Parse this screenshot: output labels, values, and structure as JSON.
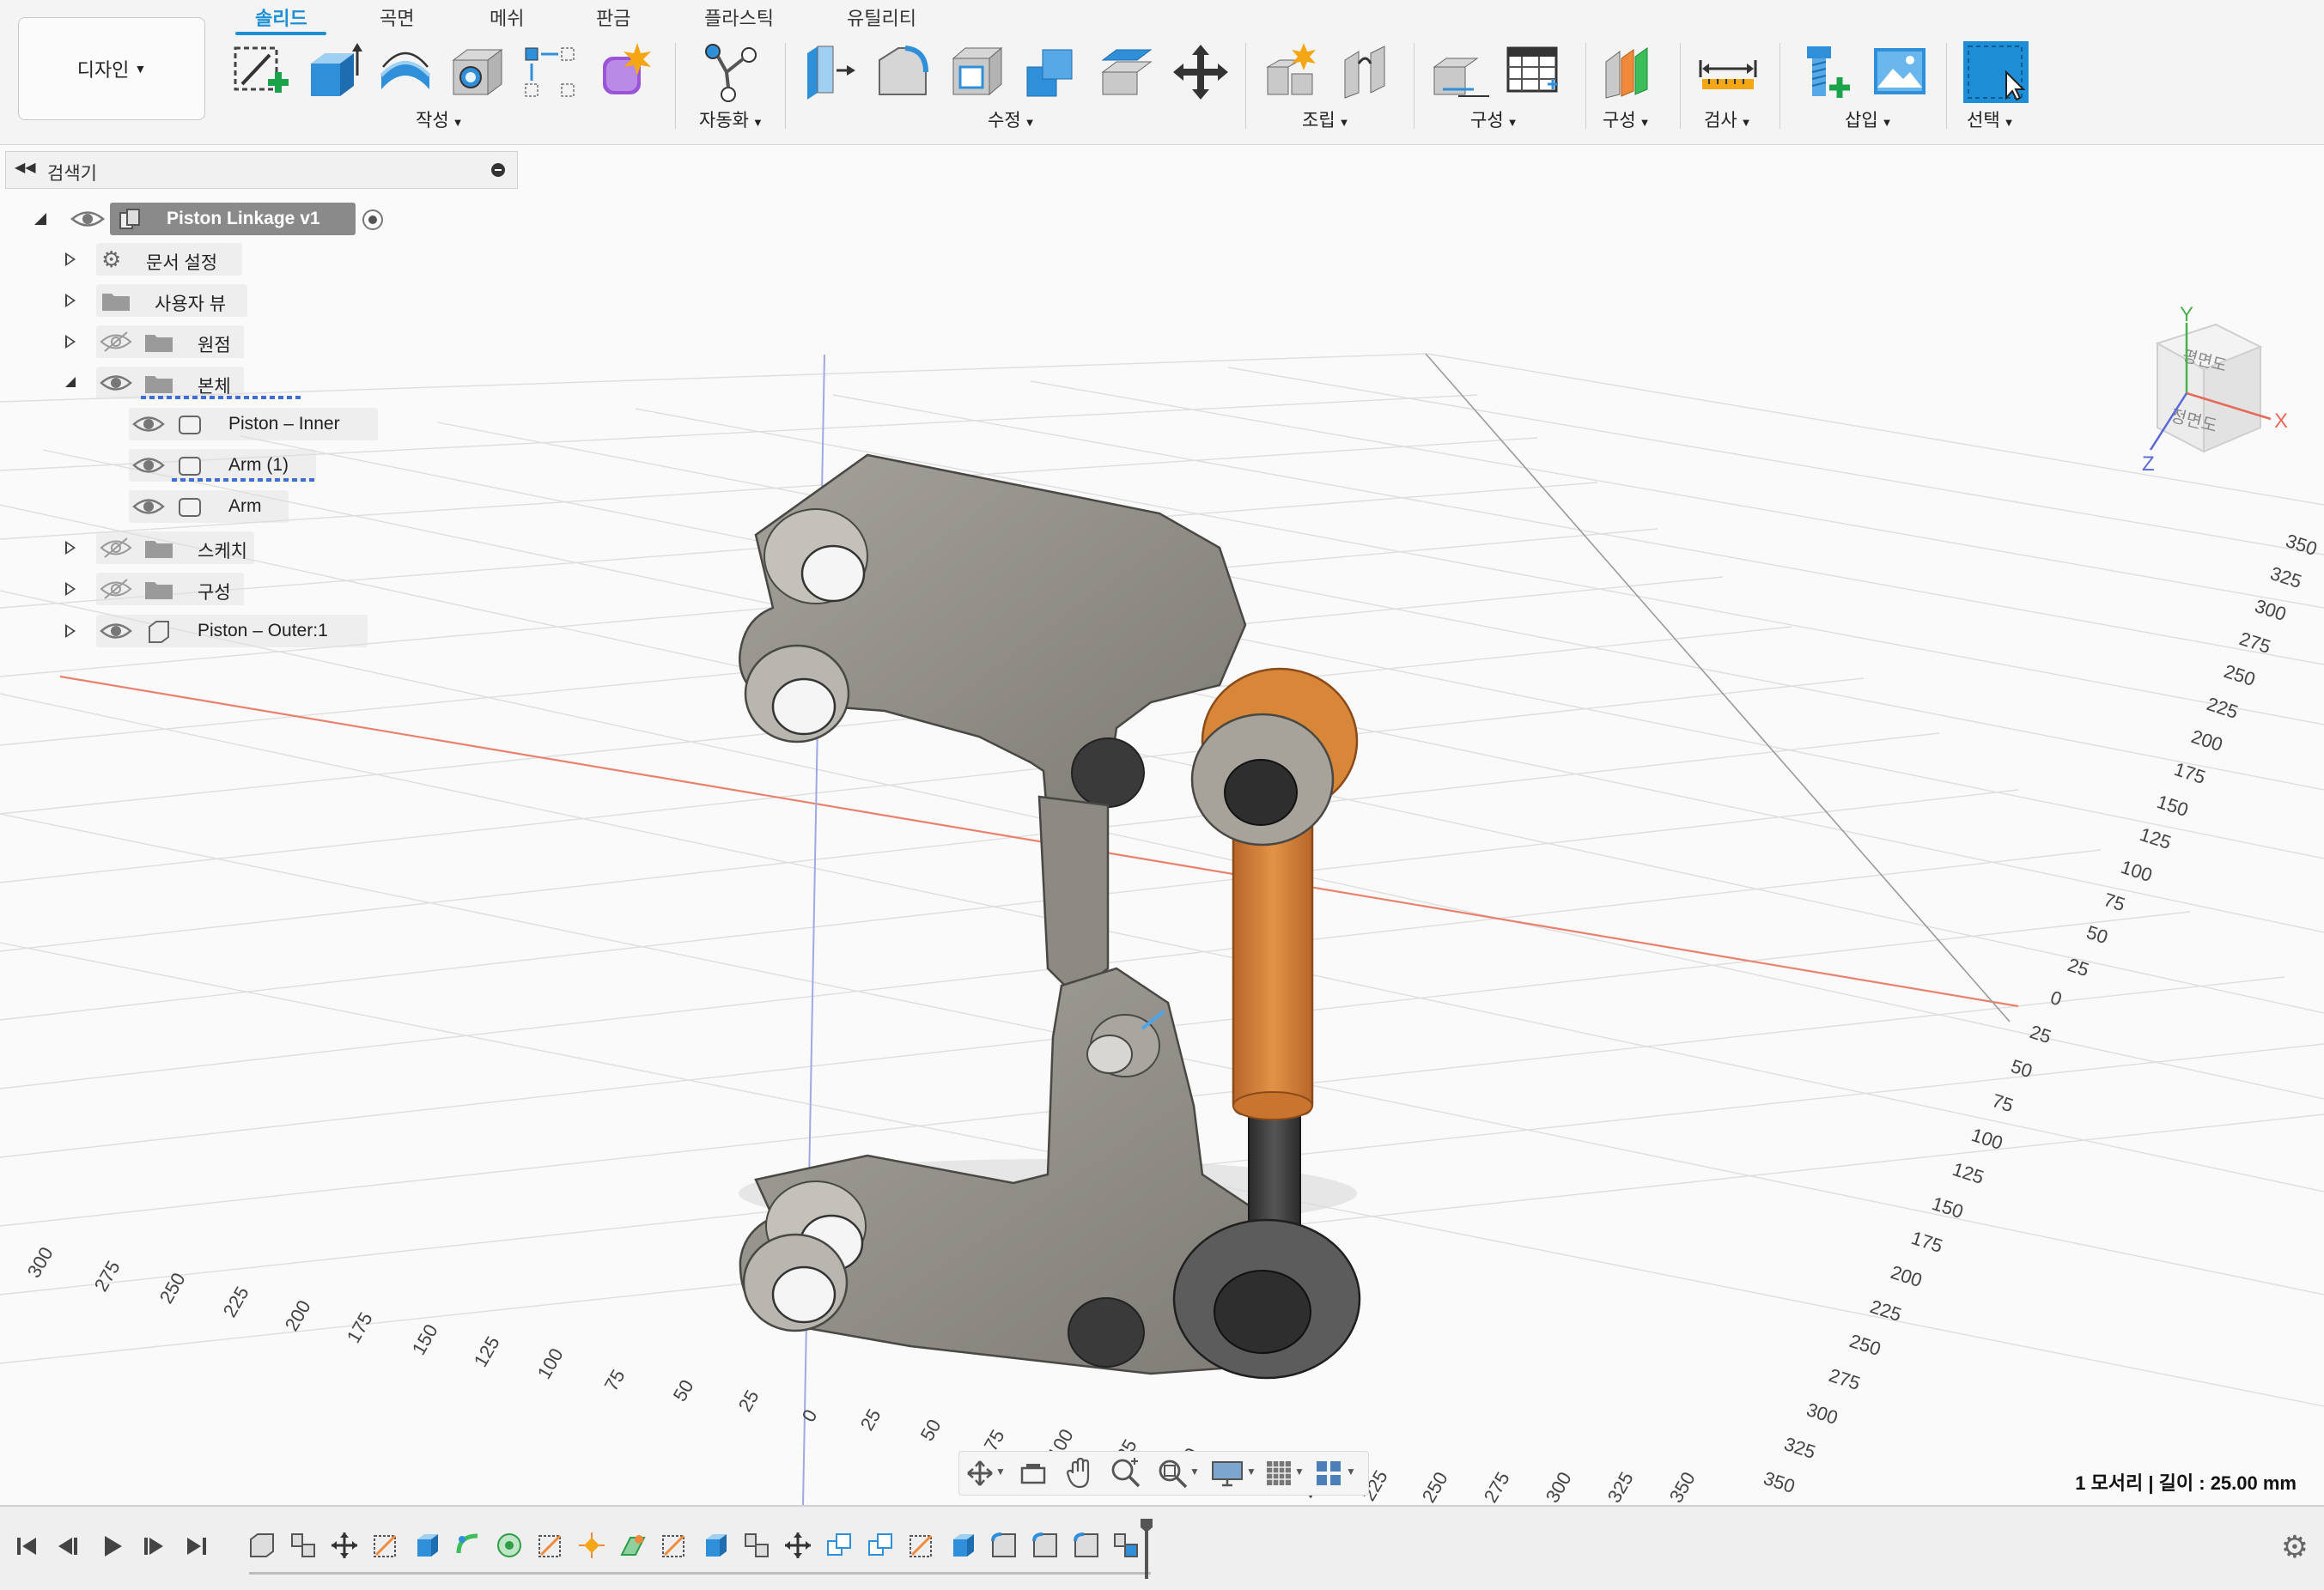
{
  "toolbar": {
    "workspace_label": "디자인",
    "tabs": [
      {
        "label": "솔리드",
        "active": true
      },
      {
        "label": "곡면",
        "active": false
      },
      {
        "label": "메쉬",
        "active": false
      },
      {
        "label": "판금",
        "active": false
      },
      {
        "label": "플라스틱",
        "active": false
      },
      {
        "label": "유틸리티",
        "active": false
      }
    ],
    "groups": {
      "create": "작성",
      "automate": "자동화",
      "modify": "수정",
      "assemble": "조립",
      "construct": "구성",
      "configure": "구성",
      "inspect": "검사",
      "insert": "삽입",
      "select": "선택"
    },
    "icons": [
      "create-sketch-icon",
      "extrude-icon",
      "revolve-icon",
      "hole-icon",
      "pattern-icon",
      "create-form-icon",
      "automate-icon",
      "press-pull-icon",
      "fillet-icon",
      "shell-icon",
      "combine-icon",
      "offset-face-icon",
      "move-icon",
      "new-component-icon",
      "joint-icon",
      "offset-plane-icon",
      "configuration-table-icon",
      "configure-icon",
      "measure-icon",
      "insert-fastener-icon",
      "insert-canvas-icon",
      "select-icon"
    ]
  },
  "browser": {
    "title": "검색기",
    "root": "Piston Linkage v1",
    "nodes": [
      {
        "label": "문서 설정"
      },
      {
        "label": "사용자 뷰"
      },
      {
        "label": "원점"
      },
      {
        "label": "본체"
      },
      {
        "label": "Piston – Inner"
      },
      {
        "label": "Arm (1)"
      },
      {
        "label": "Arm"
      },
      {
        "label": "스케치"
      },
      {
        "label": "구성"
      },
      {
        "label": "Piston – Outer:1"
      }
    ]
  },
  "viewcube": {
    "top_label": "평면도",
    "front_label": "정면도",
    "axis_x": "X",
    "axis_y": "Y",
    "axis_z": "Z"
  },
  "grid": {
    "right_ticks": [
      "350",
      "325",
      "300",
      "275",
      "250",
      "225",
      "200",
      "175",
      "150",
      "125",
      "100",
      "75",
      "50",
      "25",
      "0",
      "25",
      "50",
      "75",
      "100",
      "125",
      "150",
      "175",
      "200",
      "225",
      "250",
      "275",
      "300",
      "325",
      "350"
    ],
    "bottom_ticks": [
      "300",
      "275",
      "250",
      "225",
      "200",
      "175",
      "150",
      "125",
      "100",
      "75",
      "50",
      "25",
      "0",
      "25",
      "50",
      "75",
      "100",
      "125",
      "150",
      "175",
      "200",
      "225",
      "250",
      "275",
      "300",
      "325",
      "350"
    ],
    "colors": {
      "x_axis": "#e8826e",
      "z_axis": "#7f8fe0",
      "grid": "#dcdcdc",
      "gray_part": "#8e8b85",
      "orange_part": "#d9823a"
    }
  },
  "status": {
    "selection_text": "1 모서리 | 길이 : 25.00 mm"
  },
  "view_toolbar": {
    "icons": [
      "orbit-icon",
      "look-at-icon",
      "pan-icon",
      "zoom-icon",
      "fit-icon",
      "display-settings-icon",
      "grid-settings-icon",
      "viewports-icon"
    ]
  },
  "timeline": {
    "controls": [
      "go-to-start-icon",
      "step-back-icon",
      "play-icon",
      "step-forward-icon",
      "go-to-end-icon"
    ],
    "feature_count": 22
  }
}
